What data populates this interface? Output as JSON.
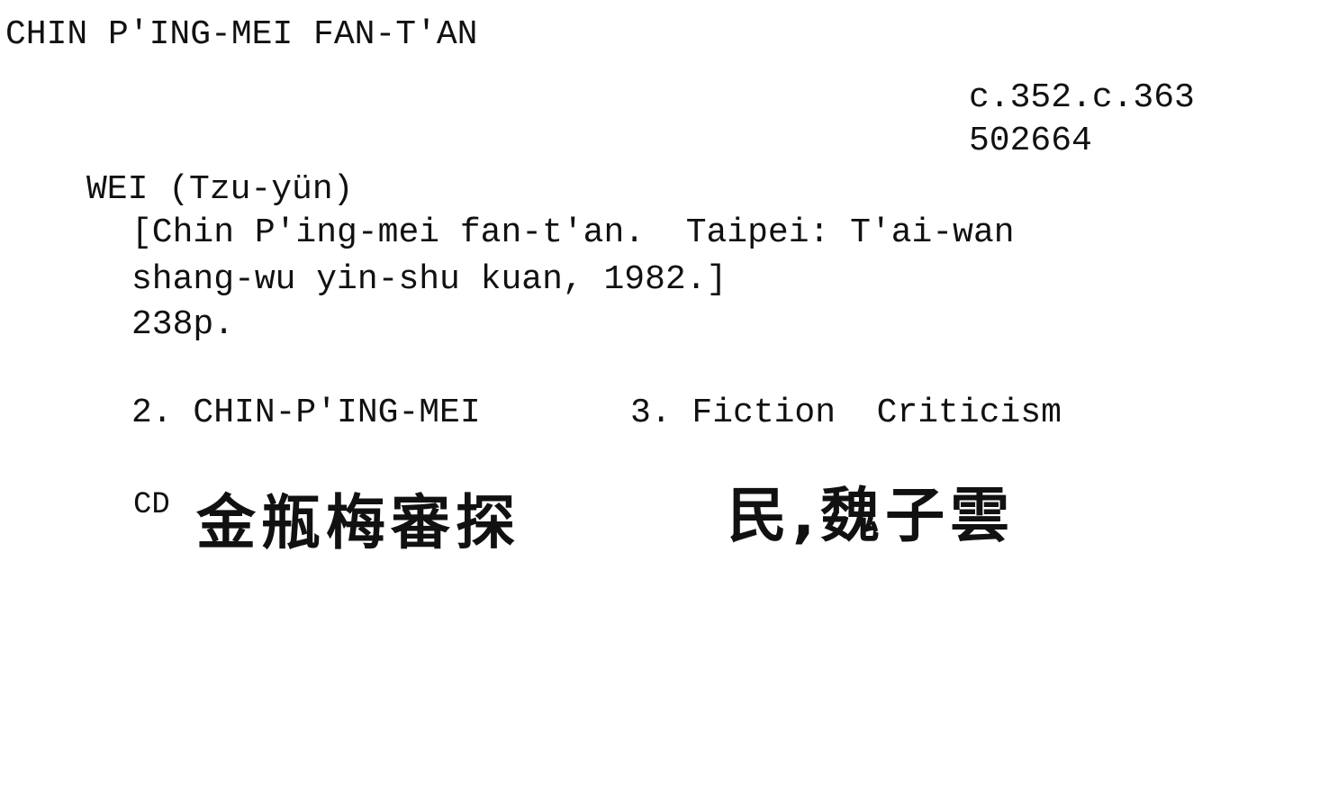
{
  "card": {
    "heading": "CHIN P'ING-MEI FAN-T'AN",
    "shelfmark": "c.352.c.363",
    "accession": "502664",
    "author": "WEI (Tzu-yün)",
    "title_line1": "[Chin P'ing-mei fan-t'an.  Taipei: T'ai-wan",
    "title_line2": "shang-wu yin-shu kuan, 1982.]",
    "pagination": "238p.",
    "subject_2": "2. CHIN-P'ING-MEI",
    "subject_3": "3. Fiction  Criticism",
    "cd_label": "CD",
    "chinese_title": "金瓶梅審探",
    "chinese_author": "民,魏子雲"
  }
}
